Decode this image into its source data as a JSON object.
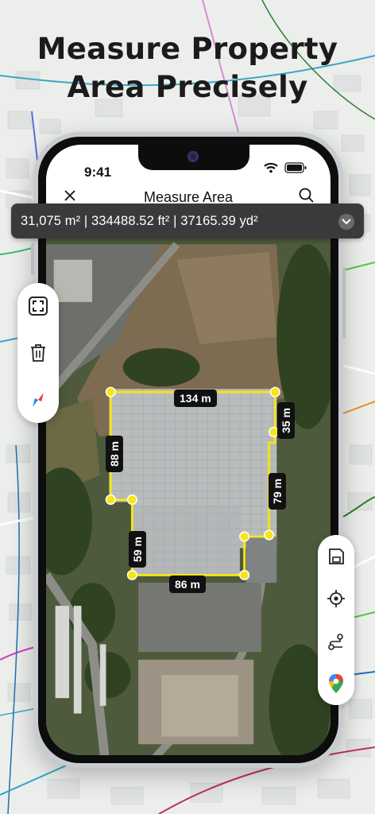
{
  "headline": {
    "line1": "Measure Property",
    "line2": "Area Precisely"
  },
  "status_bar": {
    "time": "9:41"
  },
  "app_bar": {
    "title": "Measure Area"
  },
  "measurement": {
    "summary": "31,075 m² | 334488.52 ft² | 37165.39 yd²"
  },
  "left_tools": [
    "fullscreen-icon",
    "trash-icon",
    "compass-icon"
  ],
  "right_tools": [
    "save-icon",
    "locate-icon",
    "route-icon",
    "google-maps-icon"
  ],
  "edge_labels": {
    "top": "134 m",
    "left": "88 m",
    "right_top": "35 m",
    "right": "79 m",
    "left_lower": "59 m",
    "bottom": "86 m"
  },
  "colors": {
    "polygon": "#f5e51b",
    "banner": "#3a3a3a",
    "accent_red": "#e53935",
    "accent_blue": "#1e88e5"
  }
}
